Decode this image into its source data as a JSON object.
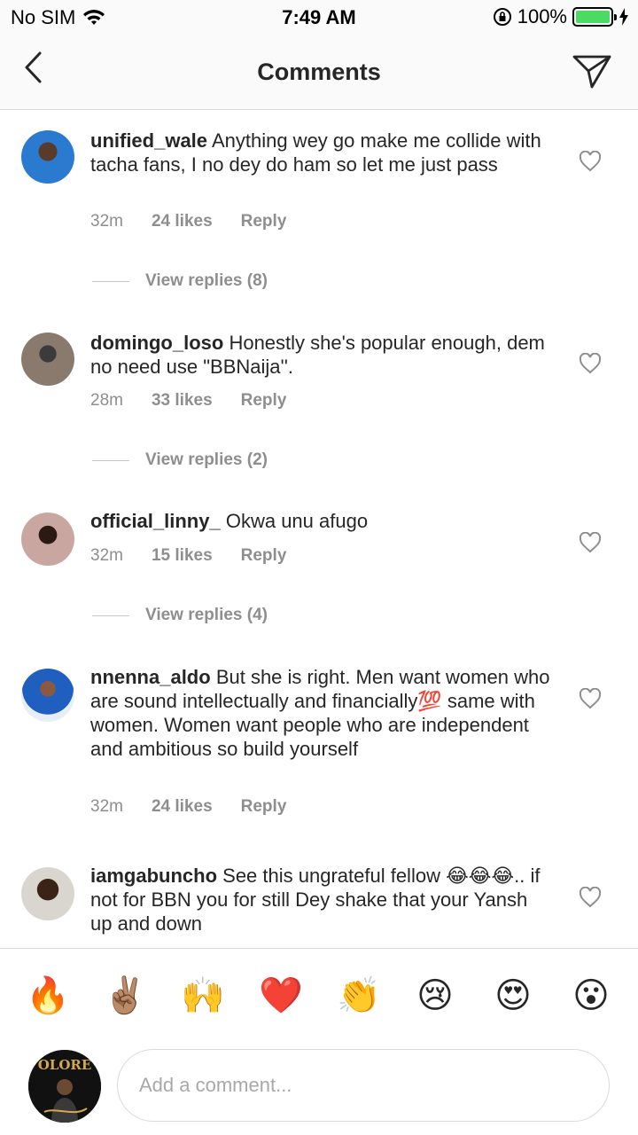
{
  "status_bar": {
    "carrier": "No SIM",
    "time": "7:49 AM",
    "battery": "100%"
  },
  "nav": {
    "title": "Comments"
  },
  "comments": [
    {
      "username": "unified_wale",
      "text": "Anything wey go make me collide with tacha fans, I no dey do ham so let me just pass",
      "time": "32m",
      "likes": "24 likes",
      "reply_label": "Reply",
      "view_replies": "View replies (8)"
    },
    {
      "username": "domingo_loso",
      "text": "Honestly she's popular enough, dem no need use \"BBNaija''.",
      "time": "28m",
      "likes": "33 likes",
      "reply_label": "Reply",
      "view_replies": "View replies (2)"
    },
    {
      "username": "official_linny_",
      "text": "Okwa unu afugo",
      "time": "32m",
      "likes": "15 likes",
      "reply_label": "Reply",
      "view_replies": "View replies (4)"
    },
    {
      "username": "nnenna_aldo",
      "text": "But she is right. Men want women who are sound intellectually and financially💯 same with women. Women want people who are independent and ambitious so build yourself",
      "time": "32m",
      "likes": "24 likes",
      "reply_label": "Reply"
    },
    {
      "username": "iamgabuncho",
      "text": "See this ungrateful fellow 😂😂😂.. if not for BBN you for still Dey shake that your Yansh up and down"
    }
  ],
  "emojis": [
    "🔥",
    "✌🏽",
    "🙌",
    "❤️",
    "👏",
    "😢",
    "😍",
    "😮"
  ],
  "input": {
    "placeholder": "Add a comment...",
    "avatar_text": "OLORE"
  },
  "colors": {
    "secondary_text": "#8e8e8e",
    "primary_text": "#262626",
    "battery": "#4cd964",
    "divider": "#dbdbdb"
  }
}
